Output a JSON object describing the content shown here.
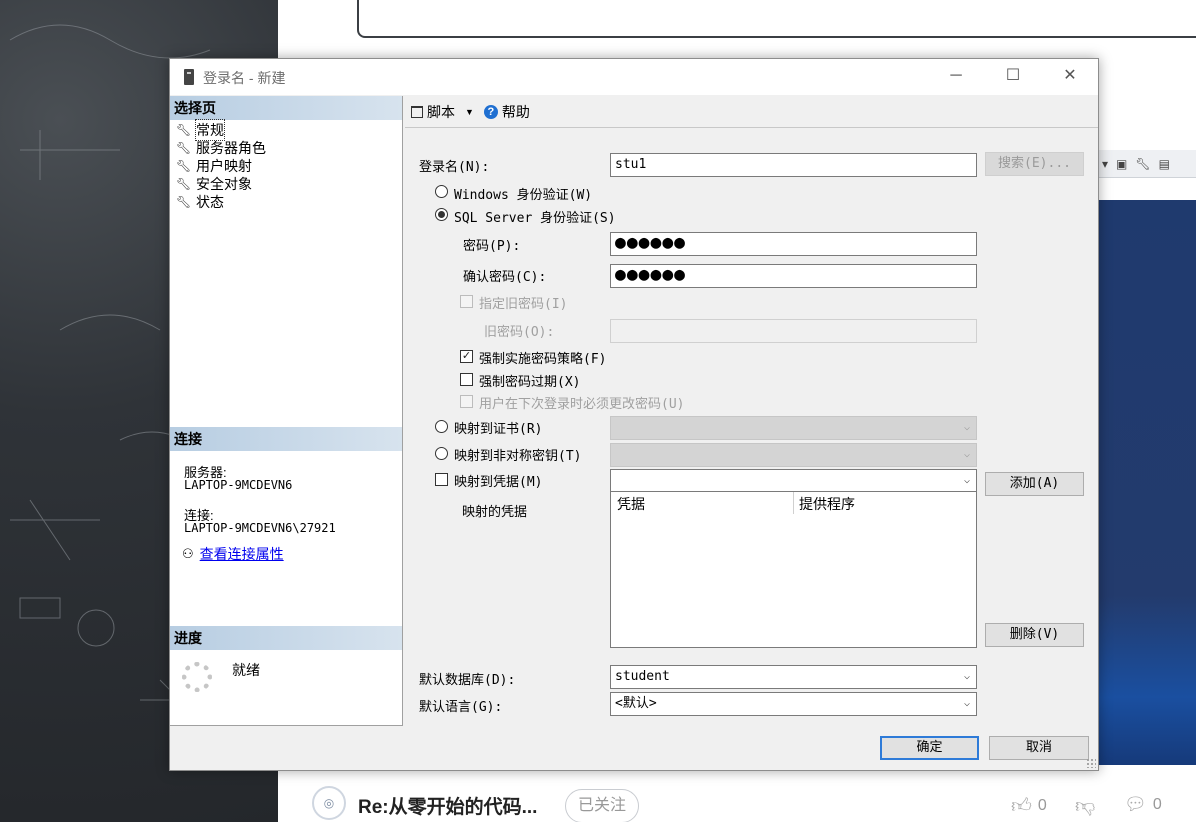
{
  "window": {
    "title": "登录名 - 新建",
    "min_glyph": "─",
    "max_glyph": "☐",
    "close_glyph": "✕"
  },
  "left_pane": {
    "select_page_header": "选择页",
    "pages": [
      {
        "label": "常规",
        "icon": "wrench-icon"
      },
      {
        "label": "服务器角色",
        "icon": "wrench-icon"
      },
      {
        "label": "用户映射",
        "icon": "wrench-icon"
      },
      {
        "label": "安全对象",
        "icon": "wrench-icon"
      },
      {
        "label": "状态",
        "icon": "wrench-icon"
      }
    ],
    "connection_header": "连接",
    "server_label": "服务器:",
    "server_value": "LAPTOP-9MCDEVN6",
    "connection_label": "连接:",
    "connection_value": "LAPTOP-9MCDEVN6\\27921",
    "view_connection_properties": "查看连接属性",
    "progress_header": "进度",
    "progress_status": "就绪"
  },
  "toolbar": {
    "script_label": "脚本",
    "help_label": "帮助"
  },
  "form": {
    "login_name_label": "登录名(N):",
    "login_name_value": "stu1",
    "search_button": "搜索(E)...",
    "windows_auth_label": "Windows 身份验证(W)",
    "sql_auth_label": "SQL Server 身份验证(S)",
    "password_label": "密码(P):",
    "password_value": "●●●●●●",
    "confirm_password_label": "确认密码(C):",
    "confirm_password_value": "●●●●●●",
    "specify_old_password_label": "指定旧密码(I)",
    "old_password_label": "旧密码(O):",
    "enforce_policy_label": "强制实施密码策略(F)",
    "enforce_policy_checked": true,
    "enforce_expiration_label": "强制密码过期(X)",
    "enforce_expiration_checked": false,
    "must_change_label": "用户在下次登录时必须更改密码(U)",
    "map_certificate_label": "映射到证书(R)",
    "map_asymmetric_key_label": "映射到非对称密钥(T)",
    "map_credential_label": "映射到凭据(M)",
    "add_button": "添加(A)",
    "mapped_credentials_label": "映射的凭据",
    "credentials_columns": [
      "凭据",
      "提供程序"
    ],
    "remove_button": "删除(V)",
    "default_database_label": "默认数据库(D):",
    "default_database_value": "student",
    "default_language_label": "默认语言(G):",
    "default_language_value": "<默认>",
    "ok_button": "确定",
    "cancel_button": "取消"
  },
  "background": {
    "footer_title": "Re:从零开始的代码...",
    "follow_label": "已关注",
    "like_count": "0",
    "comment_count": "0"
  },
  "colors": {
    "accent": "#2e7bd8",
    "section_header": "#c4d6e8",
    "link": "#0000ee"
  }
}
